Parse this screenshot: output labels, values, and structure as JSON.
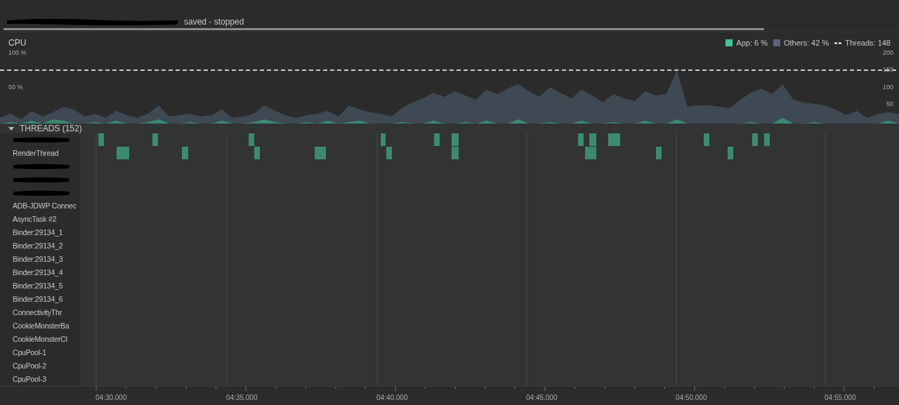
{
  "session": {
    "status": "saved - stopped"
  },
  "cpu": {
    "title": "CPU",
    "legend": [
      {
        "kind": "swatch",
        "label": "App: 6 %",
        "color": "#3fc59b"
      },
      {
        "kind": "swatch",
        "label": "Others: 42 %",
        "color": "#5b6478"
      },
      {
        "kind": "dashed",
        "label": "Threads: 148"
      }
    ],
    "left_axis": [
      "100 %",
      "50 %"
    ],
    "right_axis": [
      "200",
      "150",
      "100",
      "50"
    ]
  },
  "threads": {
    "title": "THREADS (152)",
    "expanded": true,
    "rows": [
      {
        "kind": "redacted"
      },
      {
        "kind": "label",
        "name": "RenderThread"
      },
      {
        "kind": "redacted"
      },
      {
        "kind": "redacted"
      },
      {
        "kind": "redacted"
      },
      {
        "kind": "label",
        "name": "ADB-JDWP Connec"
      },
      {
        "kind": "label",
        "name": "AsyncTask #2"
      },
      {
        "kind": "label",
        "name": "Binder:29134_1"
      },
      {
        "kind": "label",
        "name": "Binder:29134_2"
      },
      {
        "kind": "label",
        "name": "Binder:29134_3"
      },
      {
        "kind": "label",
        "name": "Binder:29134_4"
      },
      {
        "kind": "label",
        "name": "Binder:29134_5"
      },
      {
        "kind": "label",
        "name": "Binder:29134_6"
      },
      {
        "kind": "label",
        "name": "ConnectivityThr"
      },
      {
        "kind": "label",
        "name": "CookieMonsterBa"
      },
      {
        "kind": "label",
        "name": "CookieMonsterCl"
      },
      {
        "kind": "label",
        "name": "CpuPool-1"
      },
      {
        "kind": "label",
        "name": "CpuPool-2"
      },
      {
        "kind": "label",
        "name": "CpuPool-3"
      }
    ]
  },
  "timeline": {
    "ticks": [
      "04:30.000",
      "04:35.000",
      "04:40.000",
      "04:45.000",
      "04:50.000",
      "04:55.000"
    ]
  }
}
